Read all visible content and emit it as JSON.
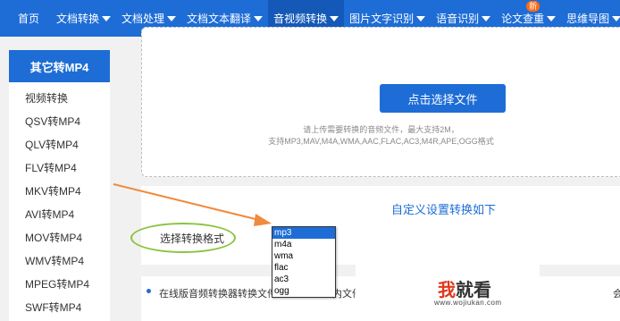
{
  "nav": {
    "home": "首页",
    "items": [
      {
        "label": "文档转换"
      },
      {
        "label": "文档处理"
      },
      {
        "label": "文档文本翻译"
      },
      {
        "label": "音视频转换"
      },
      {
        "label": "图片文字识别"
      },
      {
        "label": "语音识别"
      },
      {
        "label": "论文查重"
      },
      {
        "label": "思维导图"
      }
    ],
    "badge": "新"
  },
  "sidebar": {
    "title": "其它转MP4",
    "items": [
      {
        "label": "视频转换"
      },
      {
        "label": "QSV转MP4"
      },
      {
        "label": "QLV转MP4"
      },
      {
        "label": "FLV转MP4"
      },
      {
        "label": "MKV转MP4"
      },
      {
        "label": "AVI转MP4"
      },
      {
        "label": "MOV转MP4"
      },
      {
        "label": "WMV转MP4"
      },
      {
        "label": "MPEG转MP4"
      },
      {
        "label": "SWF转MP4"
      }
    ]
  },
  "upload": {
    "button_label": "点击选择文件",
    "hint_line1": "请上传需要转换的音频文件，最大支持2M，",
    "hint_line2": "支持MP3,MAV,M4A,WMA,AAC,FLAC,AC3,M4R,APE,OGG格式"
  },
  "settings": {
    "title": "自定义设置转换如下",
    "format_label": "选择转换格式",
    "format_options": [
      {
        "label": "mp3"
      },
      {
        "label": "m4a"
      },
      {
        "label": "wma"
      },
      {
        "label": "flac"
      },
      {
        "label": "ac3"
      },
      {
        "label": "ogg"
      }
    ],
    "selected_format": "mp3"
  },
  "footer": {
    "note_left": "在线版音频转换器转换文件",
    "note_mid": "内文件",
    "note_right": "会"
  },
  "watermark": {
    "logo_part1": "我",
    "logo_part2": "就看",
    "url": "www.wojiukan.com"
  },
  "colors": {
    "brand": "#1e6dd6",
    "nav_active": "#1559b8",
    "annotation_arrow": "#f08a3c",
    "annotation_ellipse": "#8bc43f",
    "badge": "#ff6a13"
  }
}
